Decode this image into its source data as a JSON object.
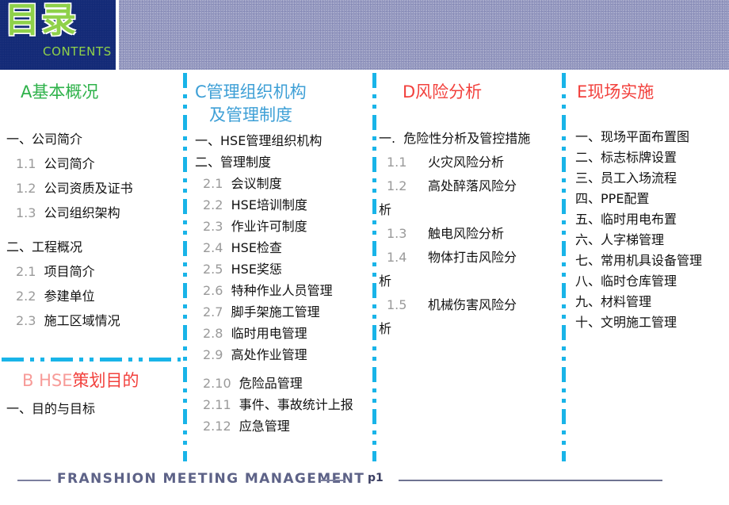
{
  "header": {
    "badge_cn": "目录",
    "badge_en": "CONTENTS",
    "badge_bg": "#132a77",
    "badge_text_color": "#8fd14a",
    "banner_color": "#9094bd"
  },
  "divider_color": "#19b4e8",
  "columns": [
    {
      "id": "A",
      "heading": "A基本概况",
      "heading_color": "#2eb24a",
      "items": [
        {
          "num": "一、",
          "text": "公司简介",
          "level": 1
        },
        {
          "num": "1.1",
          "text": "公司简介",
          "level": 2
        },
        {
          "num": "1.2",
          "text": "公司资质及证书",
          "level": 2
        },
        {
          "num": "1.3",
          "text": "公司组织架构",
          "level": 2
        },
        {
          "num": "二、",
          "text": "工程概况",
          "level": 1
        },
        {
          "num": "2.1",
          "text": "项目简介",
          "level": 2
        },
        {
          "num": "2.2",
          "text": "参建单位",
          "level": 2
        },
        {
          "num": "2.3",
          "text": "施工区域情况",
          "level": 2
        }
      ],
      "sub_section": {
        "heading_prefix": "B  HSE",
        "heading_prefix_color": "#f79b98",
        "heading_suffix": "策划目的",
        "heading_suffix_color": "#f2413d",
        "items": [
          {
            "num": "一、",
            "text": "目的与目标",
            "level": 1
          }
        ]
      }
    },
    {
      "id": "C",
      "heading_line1": "C管理组织机构",
      "heading_line2": "及管理制度",
      "heading_color": "#3d9fd6",
      "items": [
        {
          "num": "一、",
          "text": "HSE管理组织机构",
          "level": 1,
          "num_light": false,
          "text_light_prefix": "HSE"
        },
        {
          "num": "二、",
          "text": "管理制度",
          "level": 1
        },
        {
          "num": "2.1",
          "text": "会议制度",
          "level": 2
        },
        {
          "num": "2.2",
          "text": "HSE培训制度",
          "level": 2
        },
        {
          "num": "2.3",
          "text": "作业许可制度",
          "level": 2
        },
        {
          "num": "2.4",
          "text": "HSE检查",
          "level": 2
        },
        {
          "num": "2.5",
          "text": "HSE奖惩",
          "level": 2
        },
        {
          "num": "2.6",
          "text": "特种作业人员管理",
          "level": 2
        },
        {
          "num": "2.7",
          "text": "脚手架施工管理",
          "level": 2
        },
        {
          "num": "2.8",
          "text": "临时用电管理",
          "level": 2
        },
        {
          "num": "2.9",
          "text": "高处作业管理",
          "level": 2
        },
        {
          "num": "2.10",
          "text": "危险品管理",
          "level": 2
        },
        {
          "num": "2.11",
          "text": "事件、事故统计上报",
          "level": 2
        },
        {
          "num": "2.12",
          "text": "应急管理",
          "level": 2
        }
      ]
    },
    {
      "id": "D",
      "heading": "D风险分析",
      "heading_color": "#f2413d",
      "items": [
        {
          "num": "一.",
          "text": "危险性分析及管控措施",
          "level": 1
        },
        {
          "num": "1.1",
          "text": "火灾风险分析",
          "level": 2
        },
        {
          "num": "1.2",
          "text": "高处醉落风险分",
          "level": 2,
          "wrap": "析"
        },
        {
          "num": "1.3",
          "text": "触电风险分析",
          "level": 2
        },
        {
          "num": "1.4",
          "text": "物体打击风险分",
          "level": 2,
          "wrap": "析"
        },
        {
          "num": "1.5",
          "text": "机械伤害风险分",
          "level": 2,
          "wrap": "析"
        }
      ]
    },
    {
      "id": "E",
      "heading": "E现场实施",
      "heading_color": "#f2413d",
      "items": [
        {
          "num": "一、",
          "text": "现场平面布置图",
          "level": 1
        },
        {
          "num": "二、",
          "text": "标志标牌设置",
          "level": 1
        },
        {
          "num": "三、",
          "text": "员工入场流程",
          "level": 1
        },
        {
          "num": "四、",
          "text": "PPE配置",
          "level": 1
        },
        {
          "num": "五、",
          "text": "临时用电布置",
          "level": 1
        },
        {
          "num": "六、",
          "text": "人字梯管理",
          "level": 1
        },
        {
          "num": "七、",
          "text": "常用机具设备管理",
          "level": 1
        },
        {
          "num": "八、",
          "text": "临时仓库管理",
          "level": 1
        },
        {
          "num": "九、",
          "text": "材料管理",
          "level": 1
        },
        {
          "num": "十、",
          "text": "文明施工管理",
          "level": 1
        }
      ]
    }
  ],
  "footer": {
    "title": "FRANSHION  MEETING  MANAGEMENT",
    "page": "p1",
    "line_color": "#7b7f9e"
  }
}
